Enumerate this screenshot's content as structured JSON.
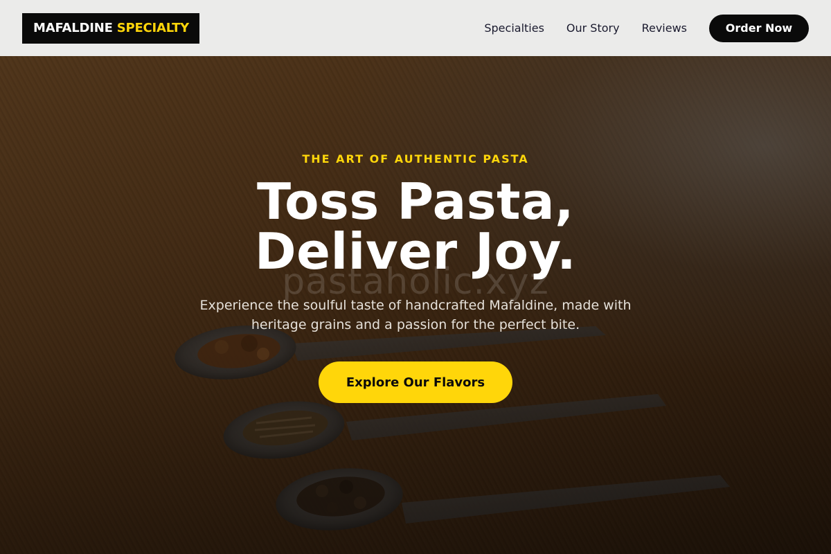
{
  "brand": {
    "name_main": "MAFALDINE",
    "name_accent": "SPECIALTY"
  },
  "nav": {
    "links": [
      {
        "label": "Specialties"
      },
      {
        "label": "Our Story"
      },
      {
        "label": "Reviews"
      }
    ],
    "cta_label": "Order Now"
  },
  "hero": {
    "eyebrow": "THE ART OF AUTHENTIC PASTA",
    "headline_line1": "Toss Pasta,",
    "headline_line2": "Deliver Joy.",
    "subtext": "Experience the soulful taste of handcrafted Mafaldine, made with heritage grains and a passion for the perfect bite.",
    "cta_label": "Explore Our Flavors",
    "watermark": "pastaholic.xyz"
  },
  "colors": {
    "accent": "#ffd60a",
    "dark": "#0a0a0a",
    "nav_bg": "#ebebea"
  }
}
